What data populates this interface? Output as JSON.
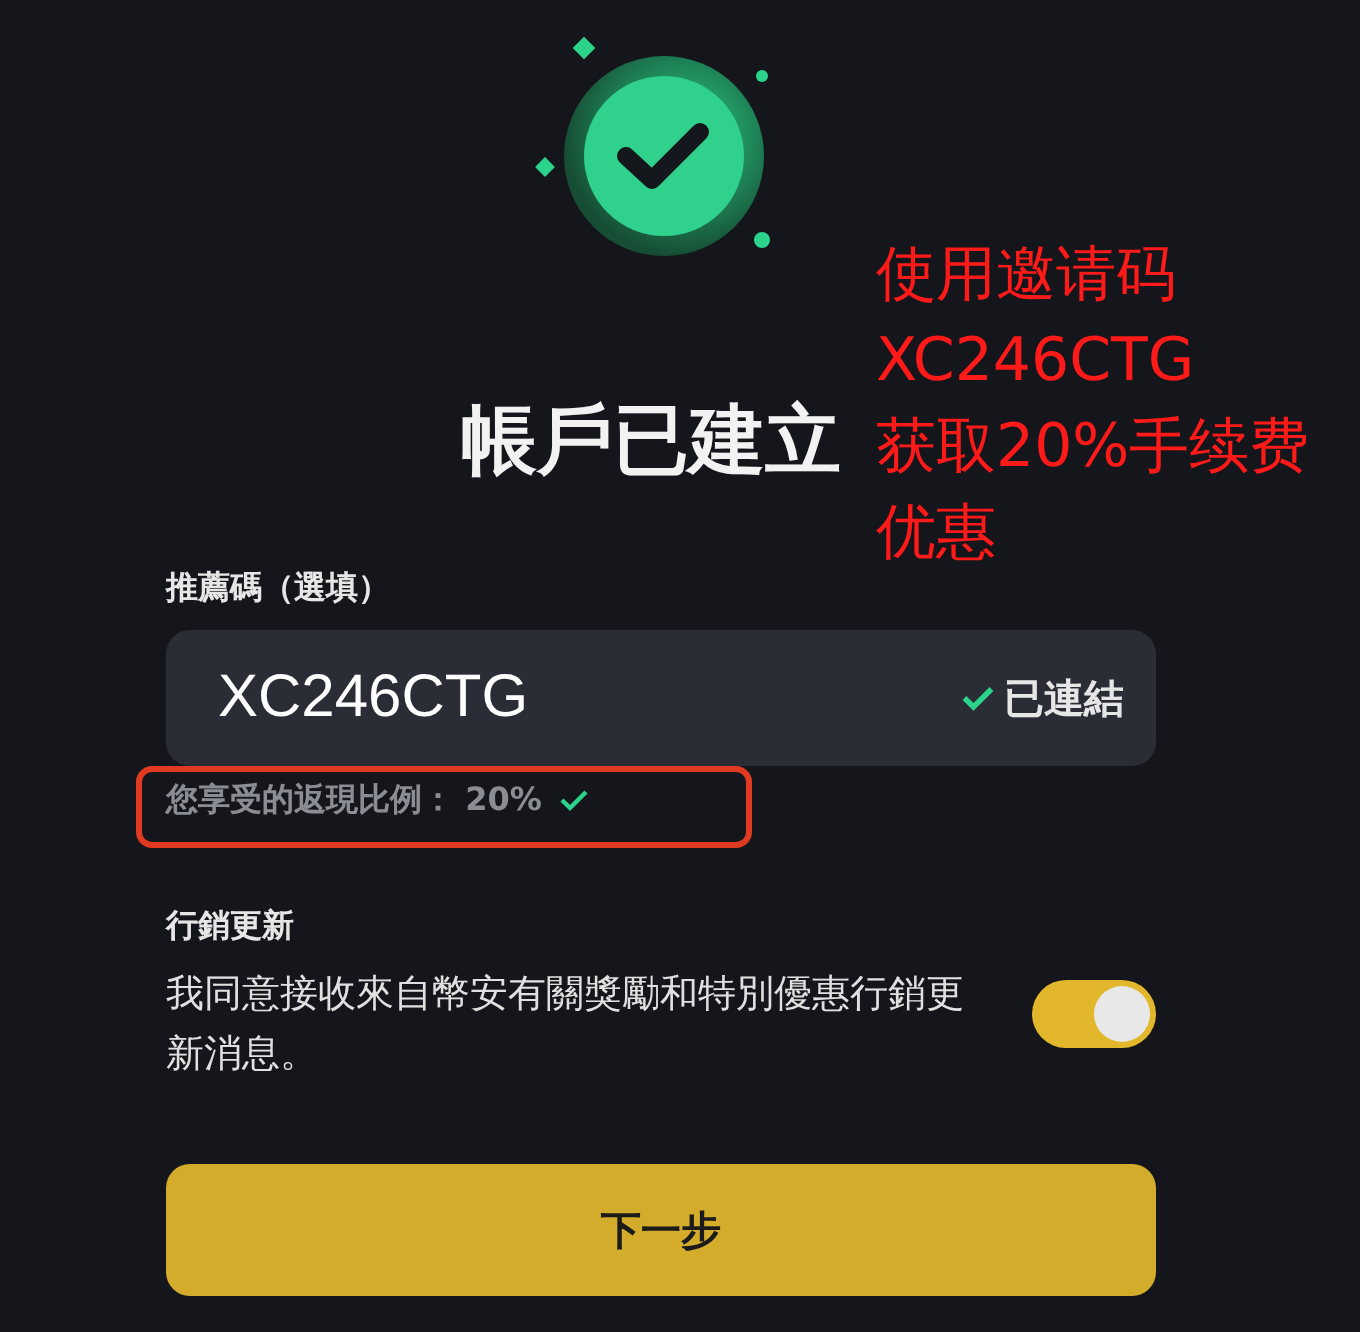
{
  "title": "帳戶已建立",
  "referral": {
    "label": "推薦碼（選填）",
    "value": "XC246CTG",
    "status": "已連結",
    "linked": true,
    "rebate": "您享受的返現比例： 20%",
    "rebate_ok": true,
    "highlighted": true
  },
  "marketing": {
    "title": "行銷更新",
    "text": "我同意接收來自幣安有關獎勵和特別優惠行銷更新消息。",
    "on": true
  },
  "next_button": "下一步",
  "caption": [
    "使用邀请码",
    "XC246CTG",
    "获取20%手续费",
    "优惠"
  ]
}
